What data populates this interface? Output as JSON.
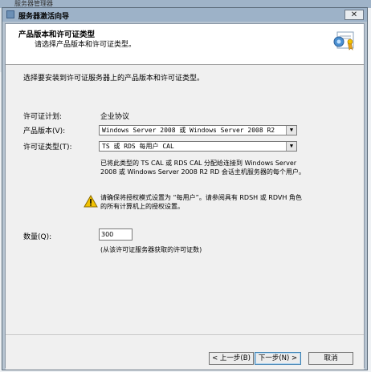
{
  "background_window": {
    "title": "服务器管理器"
  },
  "window": {
    "title": "服务器激活向导",
    "close_label": "✕"
  },
  "header": {
    "title": "产品版本和许可证类型",
    "subtitle": "请选择产品版本和许可证类型。",
    "icon": "license-certificate-icon"
  },
  "body": {
    "intro": "选择要安装到许可证服务器上的产品版本和许可证类型。",
    "program_label": "许可证计划:",
    "program_value": "企业协议",
    "version_label": "产品版本(V):",
    "version_value": "Windows Server 2008 或 Windows Server 2008 R2",
    "license_type_label": "许可证类型(T):",
    "license_type_value": "TS 或 RDS 每用户 CAL",
    "description": "已将此类型的 TS CAL 或 RDS CAL 分配给连接到 Windows Server 2008 或 Windows Server 2008 R2 RD 会话主机服务器的每个用户。",
    "warning_icon": "warning-icon",
    "warning_text": "请确保将授权模式设置为 “每用户”。请参阅具有 RDSH 或 RDVH 角色的所有计算机上的授权设置。",
    "quantity_label": "数量(Q):",
    "quantity_value": "300",
    "quantity_note": "(从该许可证服务器获取的许可证数)"
  },
  "footer": {
    "back_label": "< 上一步(B)",
    "next_label": "下一步(N) >",
    "cancel_label": "取消"
  },
  "colors": {
    "accent": "#3c7fb1",
    "title_bar": "#9db2c8",
    "warning": "#f2c200"
  }
}
